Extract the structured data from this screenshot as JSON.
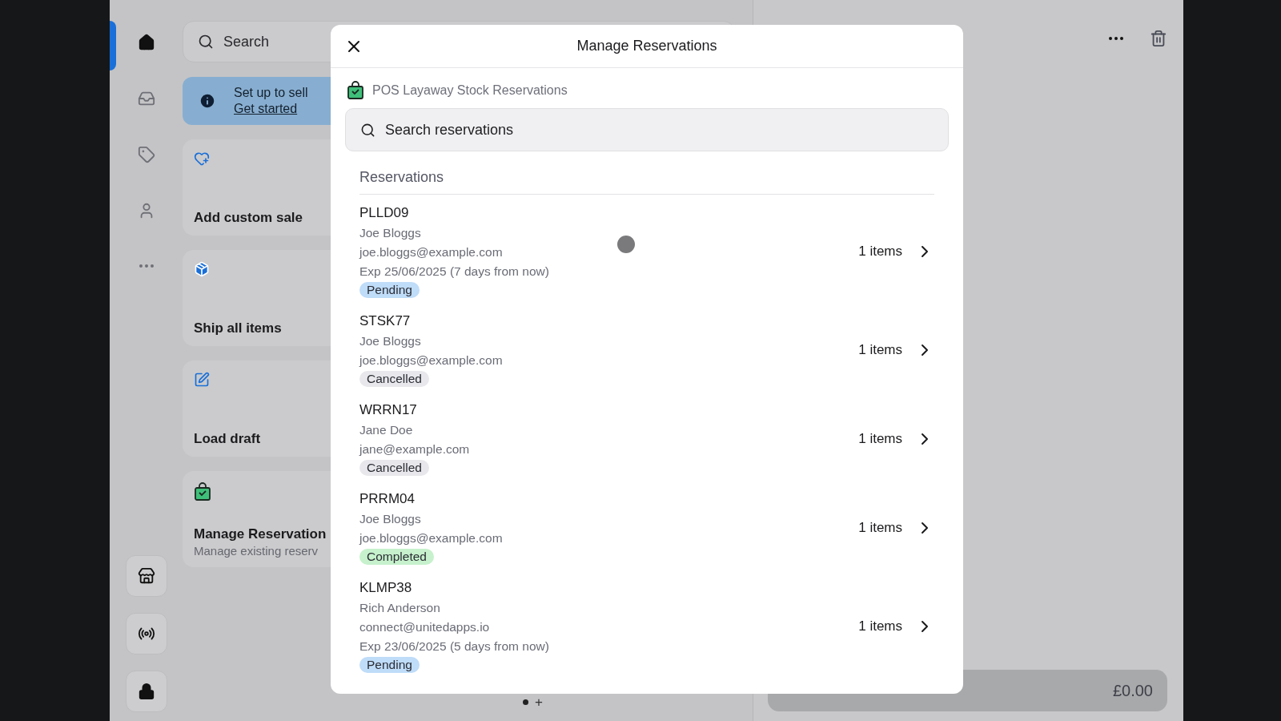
{
  "nav": [
    {
      "selected": true
    },
    {
      "selected": false
    },
    {
      "selected": false
    },
    {
      "selected": false
    }
  ],
  "search": {
    "placeholder": "Search"
  },
  "banner": {
    "title": "Set up to sell",
    "link": "Get started"
  },
  "tiles": [
    {
      "title": "Add custom sale"
    },
    {
      "title": "Ship all items"
    },
    {
      "title": "Load draft"
    },
    {
      "title": "Manage Reservation",
      "subtitle": "Manage existing reserv"
    }
  ],
  "pager": {
    "add": "+"
  },
  "checkout": {
    "total": "£0.00"
  },
  "modal": {
    "title": "Manage Reservations",
    "app_name": "POS Layaway Stock Reservations",
    "search": {
      "placeholder": "Search reservations"
    },
    "section": "Reservations",
    "reservations": [
      {
        "code": "PLLD09",
        "customer": "Joe Bloggs",
        "email": "joe.bloggs@example.com",
        "expiry": "Exp 25/06/2025 (7 days from now)",
        "count": "1 items",
        "status": {
          "kind": "pending",
          "label": "Pending"
        }
      },
      {
        "code": "STSK77",
        "customer": "Joe Bloggs",
        "email": "joe.bloggs@example.com",
        "count": "1 items",
        "status": {
          "kind": "cancelled",
          "label": "Cancelled"
        }
      },
      {
        "code": "WRRN17",
        "customer": "Jane Doe",
        "email": "jane@example.com",
        "count": "1 items",
        "status": {
          "kind": "cancelled",
          "label": "Cancelled"
        }
      },
      {
        "code": "PRRM04",
        "customer": "Joe Bloggs",
        "email": "joe.bloggs@example.com",
        "count": "1 items",
        "status": {
          "kind": "completed",
          "label": "Completed"
        }
      },
      {
        "code": "KLMP38",
        "customer": "Rich Anderson",
        "email": "connect@unitedapps.io",
        "expiry": "Exp 23/06/2025 (5 days from now)",
        "count": "1 items",
        "status": {
          "kind": "pending",
          "label": "Pending"
        }
      }
    ]
  }
}
